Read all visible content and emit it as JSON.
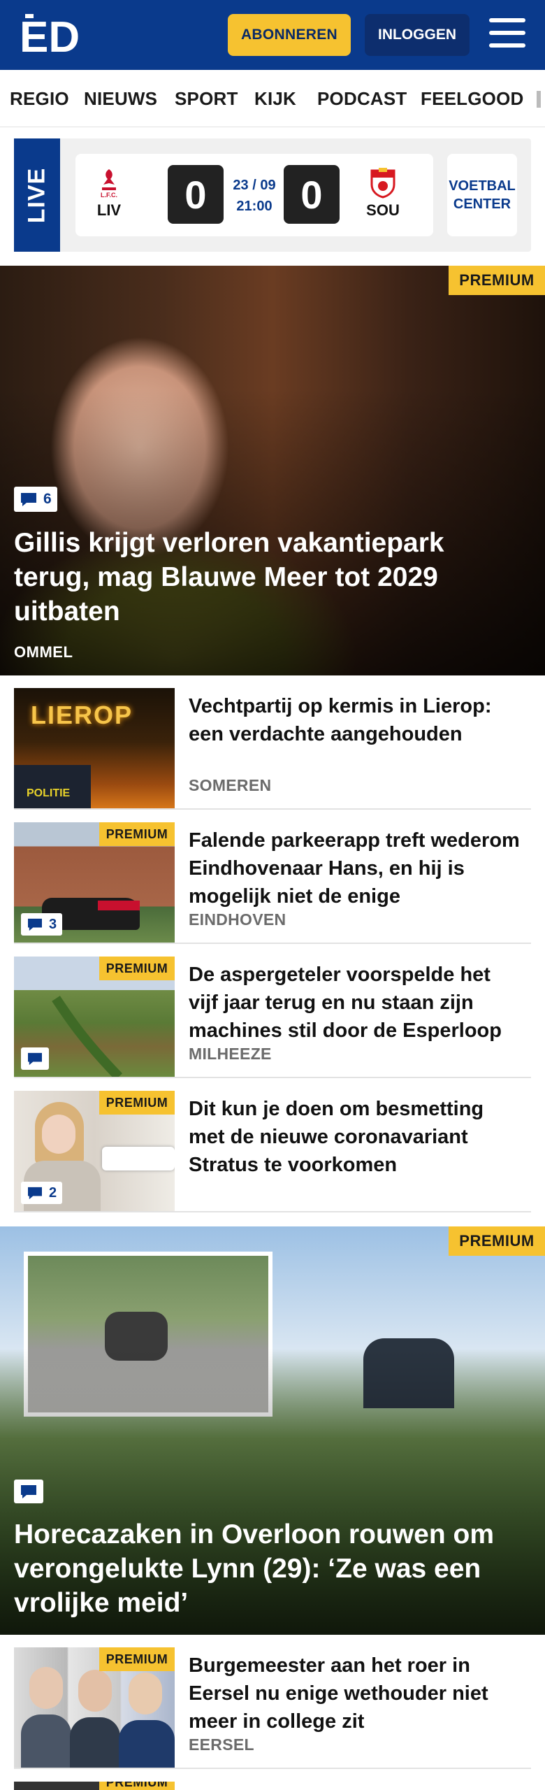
{
  "header": {
    "logo_text": "ED",
    "subscribe_label": "ABONNEREN",
    "login_label": "INLOGGEN"
  },
  "nav": [
    "REGIO",
    "NIEUWS",
    "SPORT",
    "KIJK",
    "PODCAST",
    "FEELGOOD"
  ],
  "live": {
    "tab_label": "LIVE",
    "home_team": "LIV",
    "away_team": "SOU",
    "home_score": "0",
    "away_score": "0",
    "date": "23 / 09",
    "time": "21:00",
    "center_line1": "VOETBAL",
    "center_line2": "CENTER"
  },
  "hero1": {
    "premium": "PREMIUM",
    "comments": "6",
    "title": "Gillis krijgt verloren vakantiepark terug, mag Blauwe Meer tot 2029 uitbaten",
    "kicker": "OMMEL"
  },
  "articles": [
    {
      "title": "Vechtpartij op kermis in Lierop: een verdachte aangehouden",
      "kicker": "SOMEREN",
      "premium": "",
      "comments": "",
      "sign_text": "LIEROP",
      "vest_text": "POLITIE"
    },
    {
      "title": "Falende parkeerapp treft wederom Eindhovenaar Hans, en hij is mogelijk niet de enige",
      "kicker": "EINDHOVEN",
      "premium": "PREMIUM",
      "comments": "3"
    },
    {
      "title": "De aspergeteler voorspelde het vijf jaar terug en nu staan zijn machines stil door de Esperloop",
      "kicker": "MILHEEZE",
      "premium": "PREMIUM",
      "comments": ""
    },
    {
      "title": "Dit kun je doen om besmetting met de nieuwe coronavariant Stratus te voorkomen",
      "kicker": "",
      "premium": "PREMIUM",
      "comments": "2"
    }
  ],
  "hero2": {
    "premium": "PREMIUM",
    "comments": "",
    "title": "Horecazaken in Overloon rouwen om verongelukte Lynn (29): ‘Ze was een vrolijke meid’"
  },
  "article5": {
    "title": "Burgemeester aan het roer in Eersel nu enige wethouder niet meer in college zit",
    "kicker": "EERSEL",
    "premium": "PREMIUM"
  },
  "article6": {
    "premium": "PREMIUM"
  },
  "colors": {
    "brand_blue": "#0a3a8c",
    "premium_yellow": "#f6c230",
    "liverpool_red": "#c8102e",
    "southampton_red": "#d71920"
  }
}
